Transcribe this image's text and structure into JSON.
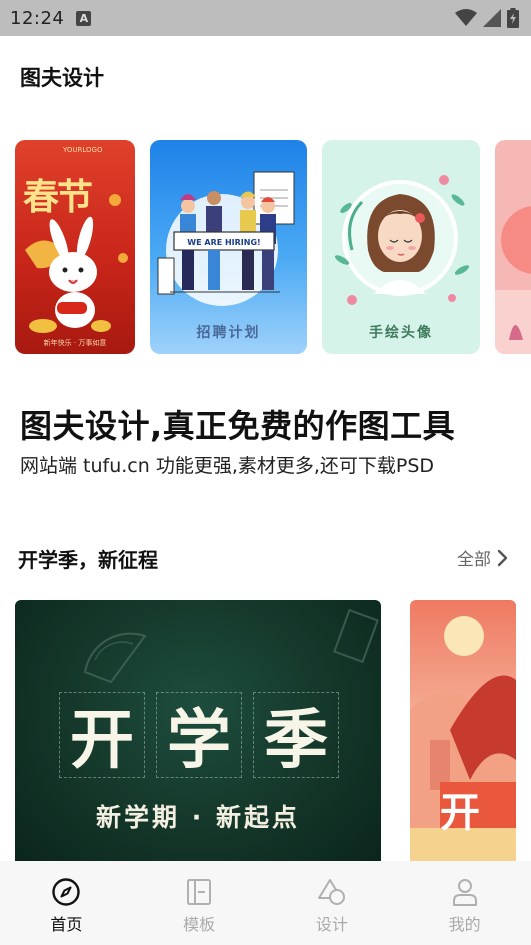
{
  "status_bar": {
    "time": "12:24",
    "notification_badge": "A"
  },
  "header": {
    "title": "图夫设计"
  },
  "carousel": [
    {
      "id": "spring",
      "caption": "",
      "big_text": "春节",
      "top_text": "YOURLOGO",
      "bottom_text": "新年快乐 · 万事如意"
    },
    {
      "id": "hiring",
      "caption": "招聘计划",
      "banner": "WE ARE HIRING!",
      "sign": "RESUME"
    },
    {
      "id": "avatar",
      "caption": "手绘头像"
    },
    {
      "id": "partial",
      "caption": ""
    }
  ],
  "headline": "图夫设计,真正免费的作图工具",
  "subline": "网站端 tufu.cn 功能更强,素材更多,还可下载PSD",
  "section": {
    "title": "开学季，新征程",
    "all_label": "全部"
  },
  "featured": {
    "chars": [
      "开",
      "学",
      "季"
    ],
    "subtitle": "新学期 · 新起点",
    "second_char": "开"
  },
  "bottom_nav": [
    {
      "label": "首页",
      "icon": "compass-icon",
      "active": true
    },
    {
      "label": "模板",
      "icon": "template-icon",
      "active": false
    },
    {
      "label": "设计",
      "icon": "shapes-icon",
      "active": false
    },
    {
      "label": "我的",
      "icon": "person-icon",
      "active": false
    }
  ],
  "colors": {
    "active": "#111111",
    "inactive": "#aaaaaa",
    "nav_bg": "#f7f7f7",
    "status_bg": "#bdbdbd"
  }
}
